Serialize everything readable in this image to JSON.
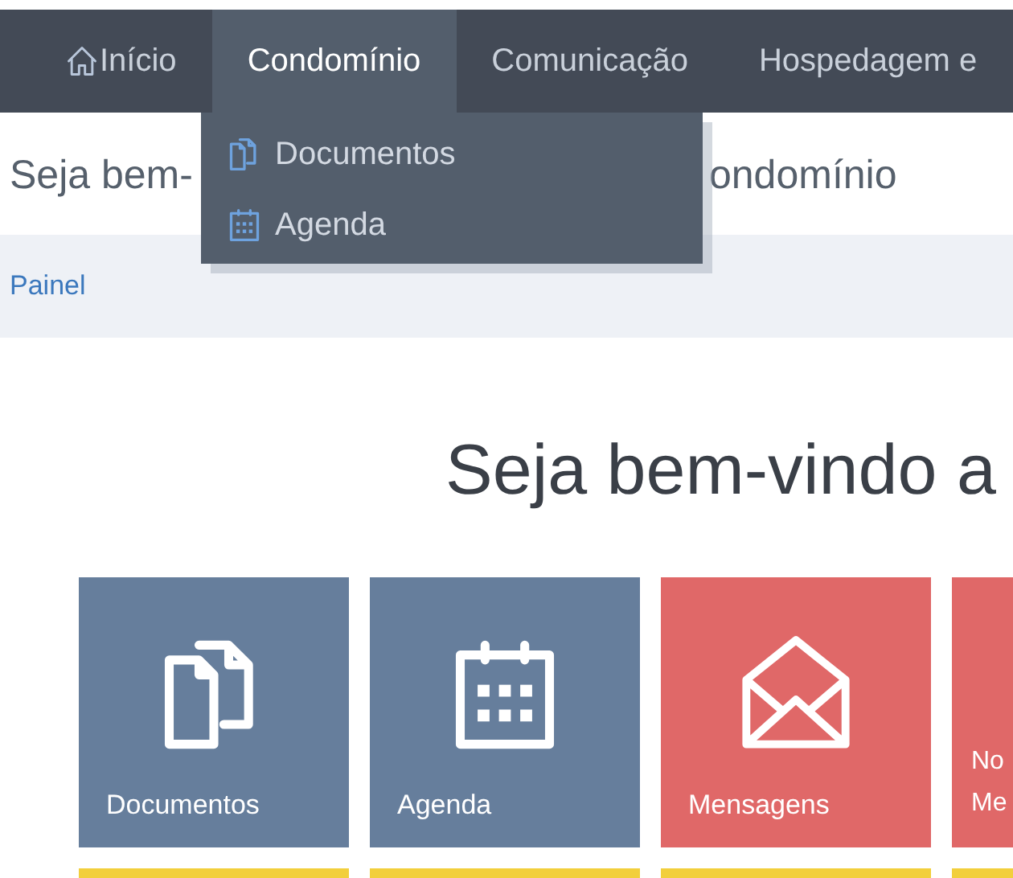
{
  "nav": [
    {
      "label": "Início",
      "kind": "home",
      "selected": false
    },
    {
      "label": "Condomínio",
      "selected": true
    },
    {
      "label": "Comunicação",
      "selected": false
    },
    {
      "label": "Hospedagem e",
      "selected": false
    }
  ],
  "dropdown": [
    {
      "label": "Documentos",
      "kind": "documents"
    },
    {
      "label": "Agenda",
      "kind": "calendar"
    }
  ],
  "page_title": {
    "start": "Seja bem-",
    "end": "ondomínio"
  },
  "breadcrumb": "Painel",
  "welcome": "Seja bem-vindo a",
  "tiles": [
    {
      "label": "Documentos",
      "kind": "documents",
      "color": "#667e9c"
    },
    {
      "label": "Agenda",
      "kind": "calendar",
      "color": "#667e9c"
    },
    {
      "label": "Mensagens",
      "kind": "envelope",
      "color": "#e06868"
    },
    {
      "label": "No Me",
      "kind": "text",
      "color": "#e06868"
    }
  ],
  "next_row_tiles": [
    {
      "color": "#f2cf3c"
    },
    {
      "color": "#f2cf3c"
    },
    {
      "color": "#f2cf3c"
    },
    {
      "color": "#f2cf3c"
    }
  ]
}
